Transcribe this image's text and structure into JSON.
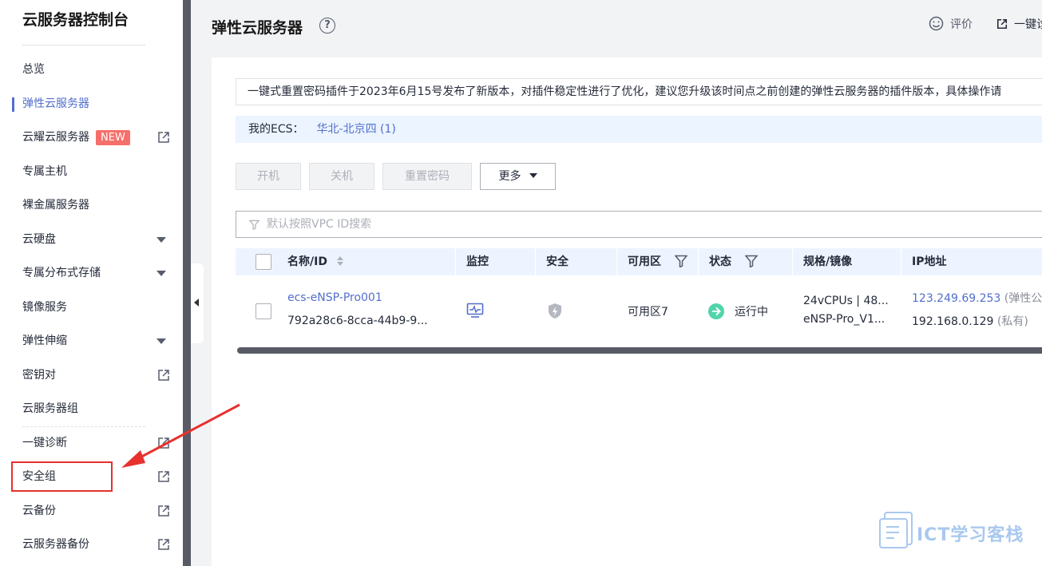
{
  "sidebar": {
    "title": "云服务器控制台",
    "items": [
      {
        "label": "总览"
      },
      {
        "label": "弹性云服务器"
      },
      {
        "label": "云耀云服务器",
        "badge": "NEW"
      },
      {
        "label": "专属主机"
      },
      {
        "label": "裸金属服务器"
      },
      {
        "label": "云硬盘"
      },
      {
        "label": "专属分布式存储"
      },
      {
        "label": "镜像服务"
      },
      {
        "label": "弹性伸缩"
      },
      {
        "label": "密钥对"
      },
      {
        "label": "云服务器组"
      },
      {
        "label": "一键诊断"
      },
      {
        "label": "安全组"
      },
      {
        "label": "云备份"
      },
      {
        "label": "云服务器备份"
      }
    ]
  },
  "header": {
    "title": "弹性云服务器",
    "help_glyph": "?",
    "rate_label": "评价",
    "onekey_label": "一键诊"
  },
  "notice": {
    "text": "一键式重置密码插件于2023年6月15号发布了新版本，对插件稳定性进行了优化，建议您升级该时间点之前创建的弹性云服务器的插件版本，具体操作请"
  },
  "region": {
    "label": "我的ECS：",
    "link": "华北-北京四 (1)"
  },
  "toolbar": {
    "start": "开机",
    "stop": "关机",
    "reset_password": "重置密码",
    "more": "更多"
  },
  "search": {
    "placeholder": "默认按照VPC ID搜索"
  },
  "table": {
    "headers": {
      "name": "名称/ID",
      "monitor": "监控",
      "security": "安全",
      "az": "可用区",
      "status": "状态",
      "spec": "规格/镜像",
      "ip": "IP地址"
    },
    "rows": [
      {
        "name": "ecs-eNSP-Pro001",
        "id": "792a28c6-8cca-44b9-9...",
        "az": "可用区7",
        "status": "运行中",
        "spec": "24vCPUs | 48...",
        "image": "eNSP-Pro_V1...",
        "public_ip": "123.249.69.253",
        "public_ip_note": "(弹性公",
        "private_ip": "192.168.0.129",
        "private_ip_note": "(私有)"
      }
    ]
  },
  "watermark": "ICT学习客栈",
  "colors": {
    "accent": "#526ecc",
    "annotation": "#e6312d",
    "running": "#50d4ab",
    "badge_new": "#f66f6a"
  }
}
